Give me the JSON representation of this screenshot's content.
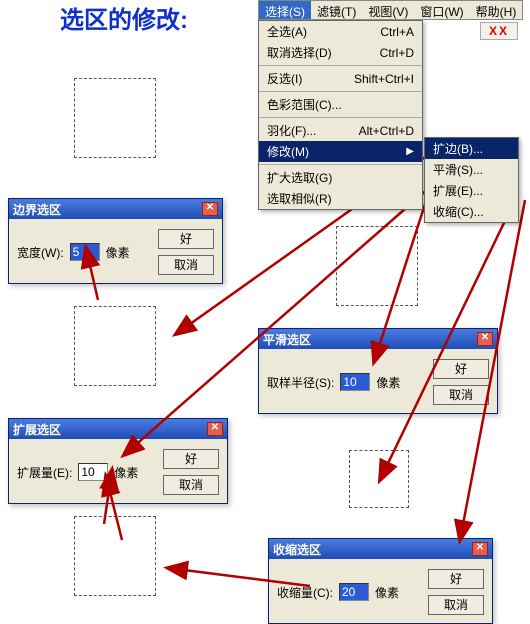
{
  "page_title": "选区的修改:",
  "menubar": {
    "items": [
      {
        "label": "选择(S)",
        "active": true
      },
      {
        "label": "滤镜(T)"
      },
      {
        "label": "视图(V)"
      },
      {
        "label": "窗口(W)"
      },
      {
        "label": "帮助(H)"
      }
    ]
  },
  "badge": "XX",
  "dropdown": {
    "groups": [
      [
        {
          "label": "全选(A)",
          "shortcut": "Ctrl+A"
        },
        {
          "label": "取消选择(D)",
          "shortcut": "Ctrl+D"
        }
      ],
      [
        {
          "label": "反选(I)",
          "shortcut": "Shift+Ctrl+I"
        }
      ],
      [
        {
          "label": "色彩范围(C)..."
        }
      ],
      [
        {
          "label": "羽化(F)...",
          "shortcut": "Alt+Ctrl+D"
        },
        {
          "label": "修改(M)",
          "submenu": true,
          "highlight": true
        }
      ],
      [
        {
          "label": "扩大选取(G)"
        },
        {
          "label": "选取相似(R)"
        }
      ]
    ]
  },
  "submenu": {
    "items": [
      {
        "label": "扩边(B)...",
        "highlight": true
      },
      {
        "label": "平滑(S)..."
      },
      {
        "label": "扩展(E)..."
      },
      {
        "label": "收缩(C)..."
      }
    ]
  },
  "dialogs": {
    "border": {
      "title": "边界选区",
      "label": "宽度(W):",
      "value": "5",
      "unit": "像素",
      "ok": "好",
      "cancel": "取消"
    },
    "smooth": {
      "title": "平滑选区",
      "label": "取样半径(S):",
      "value": "10",
      "unit": "像素",
      "ok": "好",
      "cancel": "取消"
    },
    "expand": {
      "title": "扩展选区",
      "label": "扩展量(E):",
      "value": "10",
      "unit": "像素",
      "ok": "好",
      "cancel": "取消"
    },
    "contract": {
      "title": "收缩选区",
      "label": "收缩量(C):",
      "value": "20",
      "unit": "像素",
      "ok": "好",
      "cancel": "取消"
    }
  }
}
